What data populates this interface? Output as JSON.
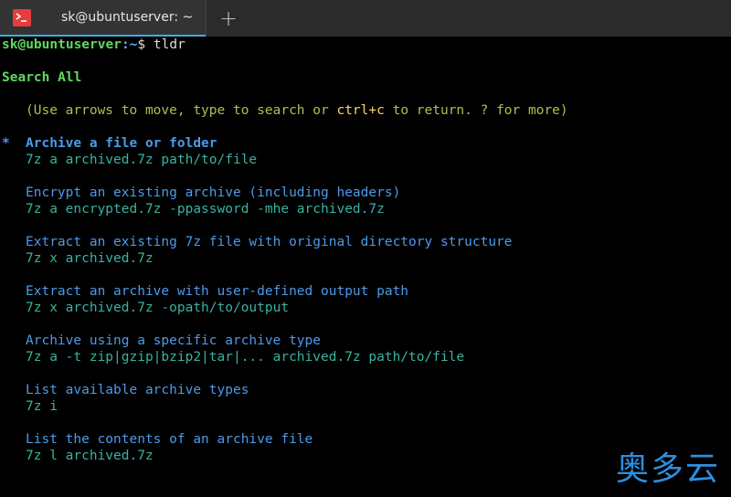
{
  "tab": {
    "title": "sk@ubuntuserver: ~",
    "new_tab_glyph": "+"
  },
  "prompt": {
    "user": "sk@ubuntuserver",
    "path": ":~",
    "dollar": "$",
    "command": " tldr"
  },
  "menu": {
    "heading": "Search All",
    "hint_a": "(Use arrows to move, type to search or ",
    "hint_key": "ctrl+c",
    "hint_b": " to return. ? for more)",
    "selected_marker": "*",
    "entries": [
      {
        "desc": "Archive a file or folder",
        "cmd": "7z a archived.7z path/to/file"
      },
      {
        "desc": "Encrypt an existing archive (including headers)",
        "cmd": "7z a encrypted.7z -ppassword -mhe archived.7z"
      },
      {
        "desc": "Extract an existing 7z file with original directory structure",
        "cmd": "7z x archived.7z"
      },
      {
        "desc": "Extract an archive with user-defined output path",
        "cmd": "7z x archived.7z -opath/to/output"
      },
      {
        "desc": "Archive using a specific archive type",
        "cmd": "7z a -t zip|gzip|bzip2|tar|... archived.7z path/to/file"
      },
      {
        "desc": "List available archive types",
        "cmd": "7z i"
      },
      {
        "desc": "List the contents of an archive file",
        "cmd": "7z l archived.7z"
      }
    ]
  },
  "watermark": "奥多云",
  "colors": {
    "prompt_user": "#5fd75f",
    "prompt_path": "#5fafff",
    "description": "#4c9aea",
    "command": "#39b3a0",
    "hint": "#a8c24e",
    "hint_key": "#ffd75f",
    "tab_icon": "#e63c3c",
    "tab_accent": "#3daee9"
  }
}
